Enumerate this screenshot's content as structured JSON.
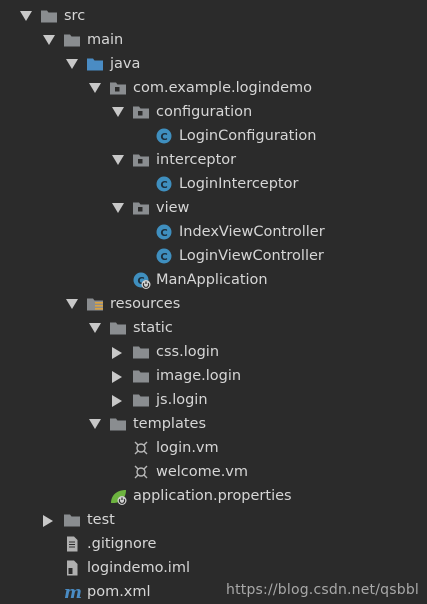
{
  "tree": [
    {
      "label": "src",
      "depth": 0,
      "arrow": "down",
      "icon": "folder-icon"
    },
    {
      "label": "main",
      "depth": 1,
      "arrow": "down",
      "icon": "folder-icon"
    },
    {
      "label": "java",
      "depth": 2,
      "arrow": "down",
      "icon": "source-folder-icon"
    },
    {
      "label": "com.example.logindemo",
      "depth": 3,
      "arrow": "down",
      "icon": "package-icon"
    },
    {
      "label": "configuration",
      "depth": 4,
      "arrow": "down",
      "icon": "package-icon"
    },
    {
      "label": "LoginConfiguration",
      "depth": 5,
      "arrow": "none",
      "icon": "class-icon"
    },
    {
      "label": "interceptor",
      "depth": 4,
      "arrow": "down",
      "icon": "package-icon"
    },
    {
      "label": "LoginInterceptor",
      "depth": 5,
      "arrow": "none",
      "icon": "class-icon"
    },
    {
      "label": "view",
      "depth": 4,
      "arrow": "down",
      "icon": "package-icon"
    },
    {
      "label": "IndexViewController",
      "depth": 5,
      "arrow": "none",
      "icon": "class-icon"
    },
    {
      "label": "LoginViewController",
      "depth": 5,
      "arrow": "none",
      "icon": "class-icon"
    },
    {
      "label": "ManApplication",
      "depth": 4,
      "arrow": "none",
      "icon": "spring-boot-class-icon"
    },
    {
      "label": "resources",
      "depth": 2,
      "arrow": "down",
      "icon": "resources-folder-icon"
    },
    {
      "label": "static",
      "depth": 3,
      "arrow": "down",
      "icon": "folder-icon"
    },
    {
      "label": "css.login",
      "depth": 4,
      "arrow": "right",
      "icon": "folder-icon"
    },
    {
      "label": "image.login",
      "depth": 4,
      "arrow": "right",
      "icon": "folder-icon"
    },
    {
      "label": "js.login",
      "depth": 4,
      "arrow": "right",
      "icon": "folder-icon"
    },
    {
      "label": "templates",
      "depth": 3,
      "arrow": "down",
      "icon": "folder-icon"
    },
    {
      "label": "login.vm",
      "depth": 4,
      "arrow": "none",
      "icon": "velocity-file-icon"
    },
    {
      "label": "welcome.vm",
      "depth": 4,
      "arrow": "none",
      "icon": "velocity-file-icon"
    },
    {
      "label": "application.properties",
      "depth": 3,
      "arrow": "none",
      "icon": "spring-properties-icon"
    },
    {
      "label": "test",
      "depth": 1,
      "arrow": "right",
      "icon": "folder-icon"
    },
    {
      "label": ".gitignore",
      "depth": 1,
      "arrow": "none",
      "icon": "text-file-icon"
    },
    {
      "label": "logindemo.iml",
      "depth": 1,
      "arrow": "none",
      "icon": "iml-file-icon"
    },
    {
      "label": "pom.xml",
      "depth": 1,
      "arrow": "none",
      "icon": "maven-icon"
    }
  ],
  "watermark": "https://blog.csdn.net/qsbbl",
  "colors": {
    "background": "#2b2b2b",
    "text": "#d6d6d6",
    "folder": "#8a8d90",
    "source_folder": "#4a8cc4",
    "class_circle": "#3f8fbf",
    "spring_green": "#6db33f"
  }
}
